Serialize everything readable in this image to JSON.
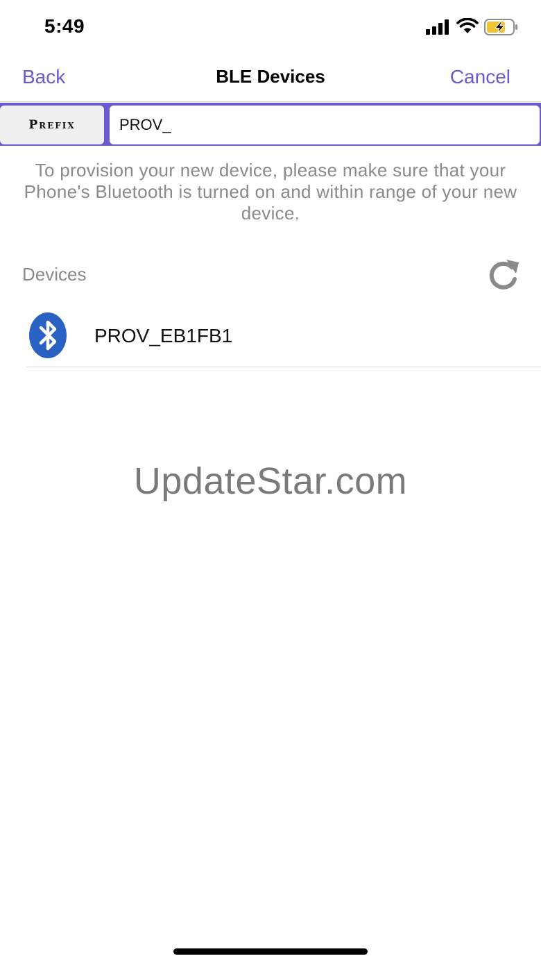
{
  "status_bar": {
    "time": "5:49",
    "icons": [
      "signal-icon",
      "wifi-icon",
      "battery-charging-icon"
    ],
    "battery_color": "#f2c230"
  },
  "nav": {
    "back_label": "Back",
    "title": "BLE Devices",
    "cancel_label": "Cancel",
    "accent_color": "#6a5acd"
  },
  "prefix": {
    "button_label": "Prefix",
    "input_value": "PROV_"
  },
  "instructions": "To provision your new device, please make sure that your Phone's Bluetooth is turned on and within range of your new device.",
  "devices": {
    "header": "Devices",
    "refresh_icon": "refresh-icon",
    "items": [
      {
        "name": "PROV_EB1FB1",
        "icon": "bluetooth-icon",
        "icon_color": "#2a62c4"
      }
    ]
  },
  "watermark": "UpdateStar.com"
}
